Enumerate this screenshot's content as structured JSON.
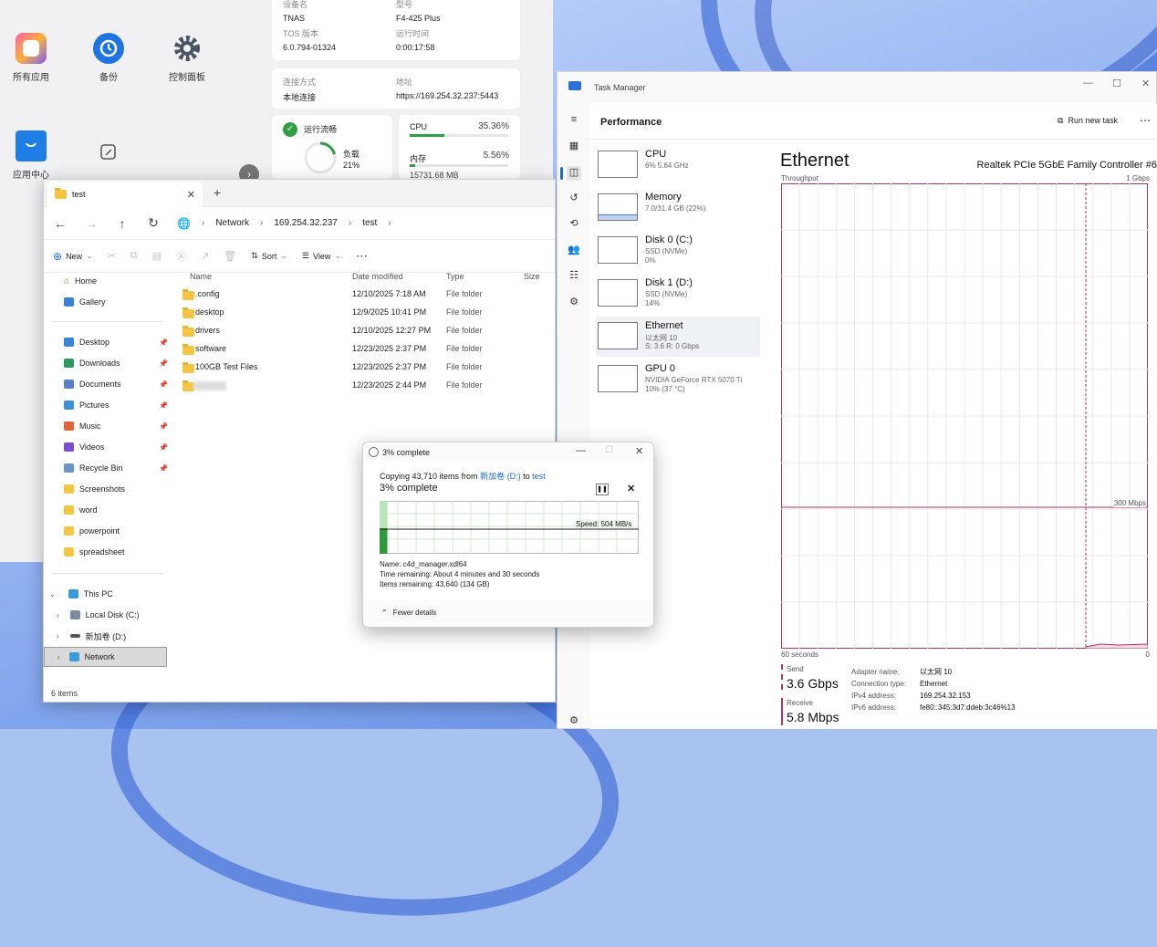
{
  "tos": {
    "apps": [
      {
        "label": "所有应用",
        "icon": "all-apps-icon"
      },
      {
        "label": "备份",
        "icon": "backup-icon"
      },
      {
        "label": "控制面板",
        "icon": "gear-icon"
      },
      {
        "label": "应用中心",
        "icon": "app-center-icon"
      },
      {
        "label": "",
        "icon": "edit-icon"
      }
    ],
    "device": {
      "name_label": "设备名",
      "name_value": "TNAS",
      "model_label": "型号",
      "model_value": "F4-425 Plus",
      "tos_label": "TOS 版本",
      "tos_value": "6.0.794-01324",
      "uptime_label": "运行时间",
      "uptime_value": "0:00:17:58"
    },
    "connection": {
      "method_label": "连接方式",
      "method_value": "本地连接",
      "address_label": "地址",
      "address_value": "https://169.254.32.237:5443"
    },
    "status": {
      "title": "运行流畅",
      "load_label": "负载",
      "load_value": "21%",
      "load_fraction": 0.21
    },
    "resources": {
      "cpu_label": "CPU",
      "cpu_value": "35.36%",
      "cpu_fraction": 0.3536,
      "mem_label": "内存",
      "mem_value": "5.56%",
      "mem_fraction": 0.0556,
      "mem_total": "15731.68 MB"
    }
  },
  "explorer": {
    "tab_title": "test",
    "breadcrumb": [
      "Network",
      "169.254.32.237",
      "test"
    ],
    "commands": {
      "new": "New",
      "sort": "Sort",
      "view": "View"
    },
    "sidebar": {
      "home": "Home",
      "gallery": "Gallery",
      "quick": [
        {
          "label": "Desktop",
          "color": "#3b82d6"
        },
        {
          "label": "Downloads",
          "color": "#2c9a5b"
        },
        {
          "label": "Documents",
          "color": "#5a7fc8"
        },
        {
          "label": "Pictures",
          "color": "#3d8fd8"
        },
        {
          "label": "Music",
          "color": "#e0633a"
        },
        {
          "label": "Videos",
          "color": "#7b4fd0"
        },
        {
          "label": "Recycle Bin",
          "color": "#6a93c9"
        },
        {
          "label": "Screenshots",
          "color": "#f4c542"
        },
        {
          "label": "word",
          "color": "#f4c542"
        },
        {
          "label": "powerpoint",
          "color": "#f4c542"
        },
        {
          "label": "spreadsheet",
          "color": "#f4c542"
        }
      ],
      "this_pc": "This PC",
      "local_disk": "Local Disk (C:)",
      "new_volume": "新加卷 (D:)",
      "network": "Network"
    },
    "columns": {
      "name": "Name",
      "date": "Date modified",
      "type": "Type",
      "size": "Size"
    },
    "files": [
      {
        "name": ".config",
        "date": "12/10/2025 7:18 AM",
        "type": "File folder"
      },
      {
        "name": "desktop",
        "date": "12/9/2025 10:41 PM",
        "type": "File folder"
      },
      {
        "name": "drivers",
        "date": "12/10/2025 12:27 PM",
        "type": "File folder"
      },
      {
        "name": "software",
        "date": "12/23/2025 2:37 PM",
        "type": "File folder"
      },
      {
        "name": "100GB Test Files",
        "date": "12/23/2025 2:37 PM",
        "type": "File folder"
      },
      {
        "name": "",
        "date": "12/23/2025 2:44 PM",
        "type": "File folder"
      }
    ],
    "status": "6 items"
  },
  "copy_dialog": {
    "title": "3% complete",
    "copying_prefix": "Copying 43,710 items from",
    "from": "新加卷 (D:)",
    "to_word": "to",
    "to": "test",
    "heading": "3% complete",
    "progress_fraction": 0.03,
    "speed": "Speed: 504 MB/s",
    "name_label": "Name:",
    "name_value": "c4d_manager.xdl64",
    "time_label": "Time remaining:",
    "time_value": "About 4 minutes and 30 seconds",
    "items_label": "Items remaining:",
    "items_value": "43,640 (134 GB)",
    "fewer_details": "Fewer details"
  },
  "task_manager": {
    "title": "Task Manager",
    "section": "Performance",
    "run_new_task": "Run new task",
    "resources": [
      {
        "name": "CPU",
        "sub1": "6% 5.64 GHz",
        "sub2": "",
        "sub3": ""
      },
      {
        "name": "Memory",
        "sub1": "7.0/31.4 GB (22%)",
        "sub2": "",
        "sub3": ""
      },
      {
        "name": "Disk 0 (C:)",
        "sub1": "SSD (NVMe)",
        "sub2": "0%",
        "sub3": ""
      },
      {
        "name": "Disk 1 (D:)",
        "sub1": "SSD (NVMe)",
        "sub2": "14%",
        "sub3": ""
      },
      {
        "name": "Ethernet",
        "sub1": "以太网 10",
        "sub2": "S: 3.6 R: 0 Gbps",
        "sub3": ""
      },
      {
        "name": "GPU 0",
        "sub1": "NVIDIA GeForce RTX 5070 Ti",
        "sub2": "10% (37 °C)",
        "sub3": ""
      }
    ],
    "detail": {
      "title": "Ethernet",
      "adapter": "Realtek PCIe 5GbE Family Controller #6",
      "throughput_label": "Throughput",
      "max_label": "1 Gbps",
      "mid_label": "300 Mbps",
      "time_label": "60 seconds",
      "zero_label": "0",
      "send_label": "Send",
      "send_value": "3.6 Gbps",
      "receive_label": "Receive",
      "receive_value": "5.8 Mbps",
      "adapter_name_label": "Adapter name:",
      "adapter_name_value": "以太网 10",
      "conn_type_label": "Connection type:",
      "conn_type_value": "Ethernet",
      "ipv4_label": "IPv4 address:",
      "ipv4_value": "169.254.32.153",
      "ipv6_label": "IPv6 address:",
      "ipv6_value": "fe80::345:3d7:ddeb:3c46%13"
    }
  }
}
